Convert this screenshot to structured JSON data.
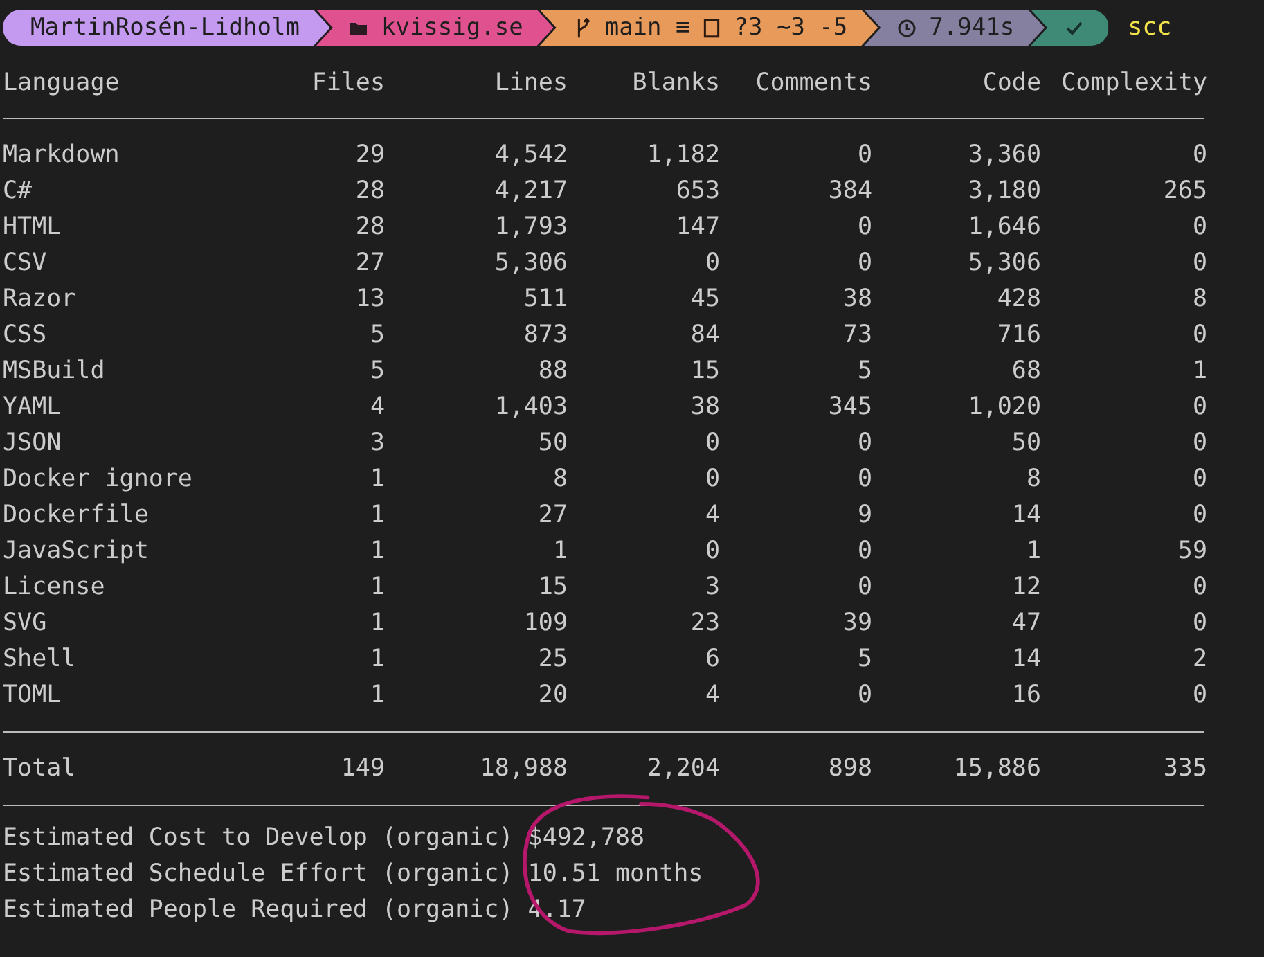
{
  "prompt": {
    "segments": [
      {
        "kind": "user",
        "text": "MartinRosén-Lidholm"
      },
      {
        "kind": "folder",
        "text": "kvissig.se"
      },
      {
        "kind": "git",
        "text": "main ≡",
        "extra": "?3 ~3 -5"
      },
      {
        "kind": "time",
        "text": "7.941s"
      },
      {
        "kind": "end"
      }
    ],
    "command": "scc"
  },
  "table": {
    "columns": [
      "Language",
      "Files",
      "Lines",
      "Blanks",
      "Comments",
      "Code",
      "Complexity"
    ],
    "rows": [
      [
        "Markdown",
        "29",
        "4,542",
        "1,182",
        "0",
        "3,360",
        "0"
      ],
      [
        "C#",
        "28",
        "4,217",
        "653",
        "384",
        "3,180",
        "265"
      ],
      [
        "HTML",
        "28",
        "1,793",
        "147",
        "0",
        "1,646",
        "0"
      ],
      [
        "CSV",
        "27",
        "5,306",
        "0",
        "0",
        "5,306",
        "0"
      ],
      [
        "Razor",
        "13",
        "511",
        "45",
        "38",
        "428",
        "8"
      ],
      [
        "CSS",
        "5",
        "873",
        "84",
        "73",
        "716",
        "0"
      ],
      [
        "MSBuild",
        "5",
        "88",
        "15",
        "5",
        "68",
        "1"
      ],
      [
        "YAML",
        "4",
        "1,403",
        "38",
        "345",
        "1,020",
        "0"
      ],
      [
        "JSON",
        "3",
        "50",
        "0",
        "0",
        "50",
        "0"
      ],
      [
        "Docker ignore",
        "1",
        "8",
        "0",
        "0",
        "8",
        "0"
      ],
      [
        "Dockerfile",
        "1",
        "27",
        "4",
        "9",
        "14",
        "0"
      ],
      [
        "JavaScript",
        "1",
        "1",
        "0",
        "0",
        "1",
        "59"
      ],
      [
        "License",
        "1",
        "15",
        "3",
        "0",
        "12",
        "0"
      ],
      [
        "SVG",
        "1",
        "109",
        "23",
        "39",
        "47",
        "0"
      ],
      [
        "Shell",
        "1",
        "25",
        "6",
        "5",
        "14",
        "2"
      ],
      [
        "TOML",
        "1",
        "20",
        "4",
        "0",
        "16",
        "0"
      ]
    ],
    "total": [
      "Total",
      "149",
      "18,988",
      "2,204",
      "898",
      "15,886",
      "335"
    ]
  },
  "estimates": [
    "Estimated Cost to Develop (organic) $492,788",
    "Estimated Schedule Effort (organic) 10.51 months",
    "Estimated People Required (organic) 4.17"
  ]
}
